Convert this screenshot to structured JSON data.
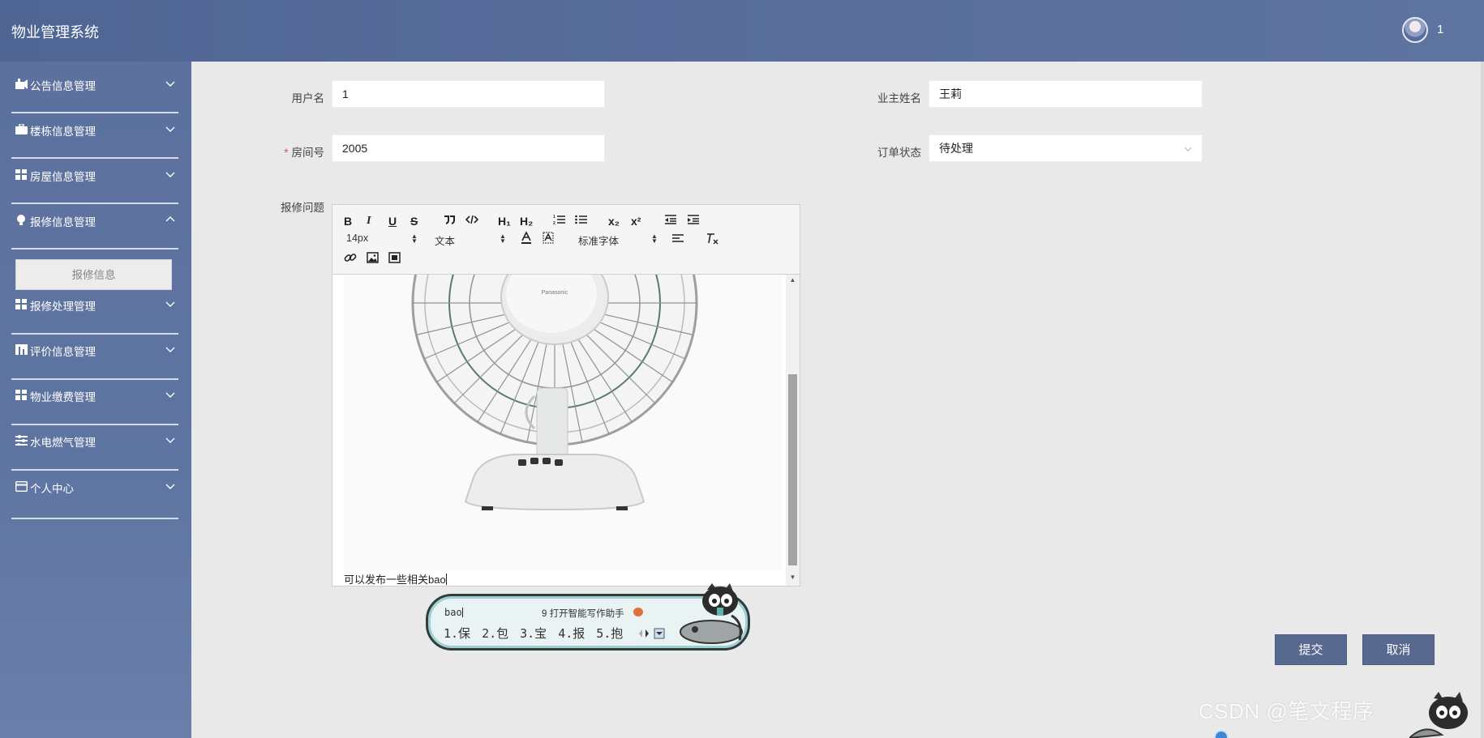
{
  "header": {
    "title": "物业管理系统",
    "user_name": "1"
  },
  "sidebar": {
    "items": [
      {
        "label": "公告信息管理",
        "icon": "notice-icon",
        "expanded": false
      },
      {
        "label": "楼栋信息管理",
        "icon": "briefcase-icon",
        "expanded": false
      },
      {
        "label": "房屋信息管理",
        "icon": "grid-icon",
        "expanded": false
      },
      {
        "label": "报修信息管理",
        "icon": "bulb-icon",
        "expanded": true,
        "children": [
          "报修信息"
        ]
      },
      {
        "label": "报修处理管理",
        "icon": "grid-icon",
        "expanded": false
      },
      {
        "label": "评价信息管理",
        "icon": "chart-icon",
        "expanded": false
      },
      {
        "label": "物业缴费管理",
        "icon": "grid-icon",
        "expanded": false
      },
      {
        "label": "水电燃气管理",
        "icon": "list-icon",
        "expanded": false
      },
      {
        "label": "个人中心",
        "icon": "card-icon",
        "expanded": false
      }
    ]
  },
  "form": {
    "username": {
      "label": "用户名",
      "value": "1"
    },
    "owner_name": {
      "label": "业主姓名",
      "value": "王莉"
    },
    "room_no": {
      "label": "房间号",
      "value": "2005",
      "required_mark": "*"
    },
    "order_status": {
      "label": "订单状态",
      "value": "待处理"
    },
    "issue": {
      "label": "报修问题"
    }
  },
  "editor": {
    "toolbar": {
      "buttons": [
        "bold",
        "italic",
        "underline",
        "strike",
        "quote",
        "code",
        "h1",
        "h2",
        "ordered-list",
        "bullet-list",
        "subscript",
        "superscript",
        "outdent",
        "indent",
        "color",
        "background",
        "align",
        "clean",
        "link",
        "image",
        "video"
      ],
      "labels": {
        "bold": "B",
        "italic": "I",
        "underline": "U",
        "strike": "S",
        "h1": "H₁",
        "h2": "H₂",
        "sub": "x₂",
        "sup": "x²"
      },
      "font_size": "14px",
      "header": "文本",
      "font": "标准字体"
    },
    "content_text": "可以发布一些相关bao"
  },
  "ime": {
    "input": "bao",
    "tip_number": "9",
    "tip": "打开智能写作助手",
    "candidates": [
      "1.保",
      "2.包",
      "3.宝",
      "4.报",
      "5.抱"
    ]
  },
  "buttons": {
    "submit": "提交",
    "cancel": "取消"
  },
  "watermark": "CSDN @笔文程序"
}
